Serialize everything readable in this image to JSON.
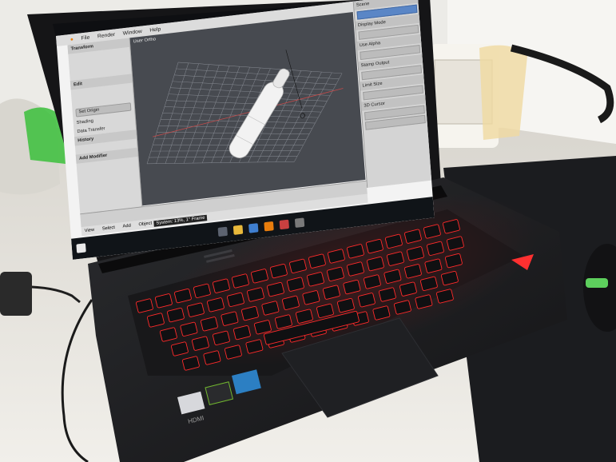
{
  "app": {
    "menu": [
      "File",
      "Render",
      "Window",
      "Help"
    ],
    "viewport_label": "User Ortho",
    "left_panel": {
      "section_transform": "Transform",
      "section_edit": "Edit",
      "button_set_origin": "Set Origin",
      "item_shading": "Shading",
      "item_data_transfer": "Data Transfer",
      "section_history": "History",
      "section_add_modifier": "Add Modifier"
    },
    "right_panel": {
      "header": "Scene",
      "items": [
        "Display Mode",
        "Use Alpha",
        "Stamp Output",
        "Limit Size",
        "3D Cursor"
      ]
    },
    "bottom_bar": [
      "View",
      "Select",
      "Add",
      "Object"
    ],
    "status": "System: 13%, 1° Frame"
  },
  "laptop": {
    "brand_badge": "HDMI",
    "keyboard_lighting": "red backlit"
  },
  "colors": {
    "key_glow": "#ff2a2a",
    "viewport_bg": "#474a50",
    "grid": "#8a8e96",
    "object": "#f2f2f2",
    "taskbar": "#101418"
  },
  "icons": [
    "blender-logo-icon",
    "windows-start-icon",
    "search-icon",
    "file-explorer-icon",
    "browser-icon",
    "intel-sticker-icon",
    "nvidia-sticker-icon"
  ]
}
